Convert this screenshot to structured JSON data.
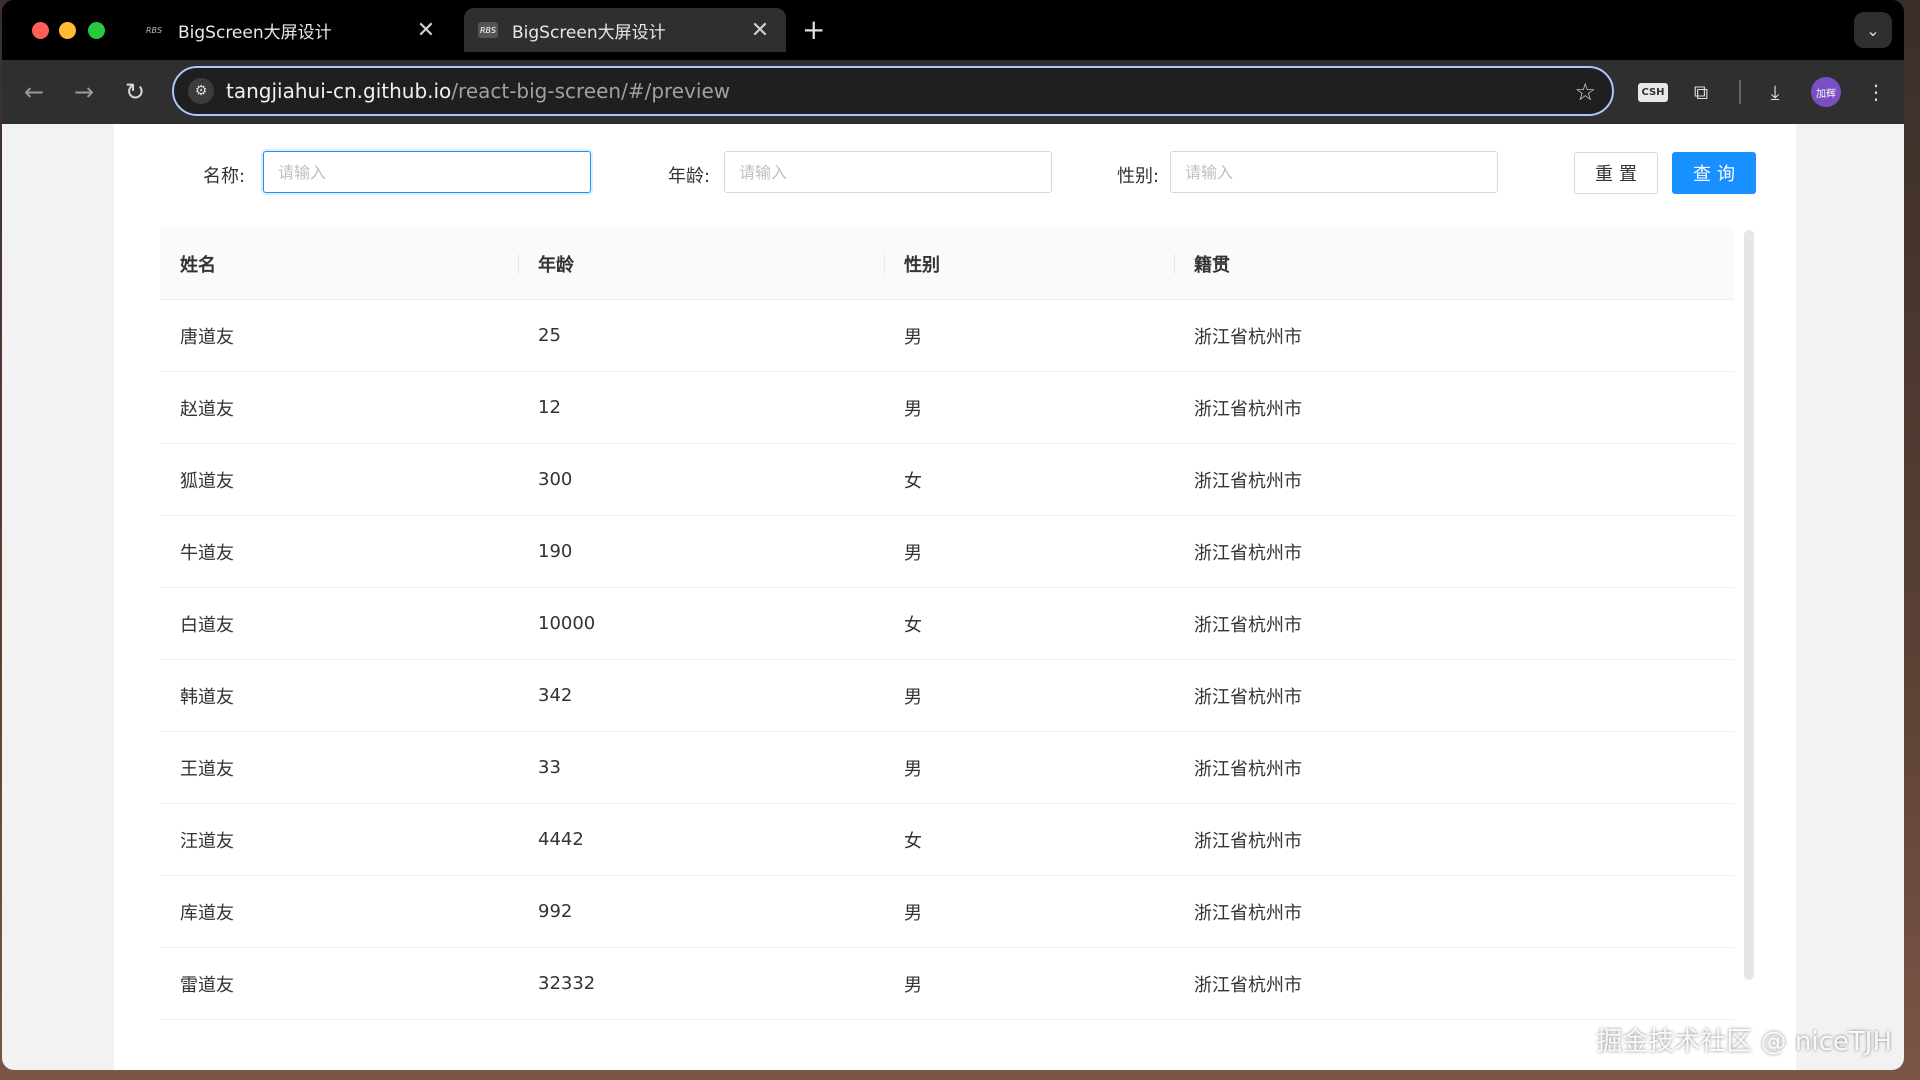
{
  "browser": {
    "tabs": [
      {
        "favicon": "RBS",
        "title": "BigScreen大屏设计",
        "close": "✕"
      },
      {
        "favicon": "RBS",
        "title": "BigScreen大屏设计",
        "close": "✕"
      }
    ],
    "new_tab": "+",
    "url_host": "tangjiahui-cn.github.io",
    "url_path": "/react-big-screen/#/preview",
    "extension_label": "CSH",
    "avatar_label": "加辉"
  },
  "form": {
    "name_label": "名称:",
    "name_placeholder": "请输入",
    "age_label": "年龄:",
    "age_placeholder": "请输入",
    "gender_label": "性别:",
    "gender_placeholder": "请输入",
    "reset_label": "重置",
    "query_label": "查询"
  },
  "table": {
    "headers": [
      "姓名",
      "年龄",
      "性别",
      "籍贯"
    ],
    "rows": [
      [
        "唐道友",
        "25",
        "男",
        "浙江省杭州市"
      ],
      [
        "赵道友",
        "12",
        "男",
        "浙江省杭州市"
      ],
      [
        "狐道友",
        "300",
        "女",
        "浙江省杭州市"
      ],
      [
        "牛道友",
        "190",
        "男",
        "浙江省杭州市"
      ],
      [
        "白道友",
        "10000",
        "女",
        "浙江省杭州市"
      ],
      [
        "韩道友",
        "342",
        "男",
        "浙江省杭州市"
      ],
      [
        "王道友",
        "33",
        "男",
        "浙江省杭州市"
      ],
      [
        "汪道友",
        "4442",
        "女",
        "浙江省杭州市"
      ],
      [
        "库道友",
        "992",
        "男",
        "浙江省杭州市"
      ],
      [
        "雷道友",
        "32332",
        "男",
        "浙江省杭州市"
      ]
    ]
  },
  "watermark": "掘金技术社区 @ niceTJH"
}
